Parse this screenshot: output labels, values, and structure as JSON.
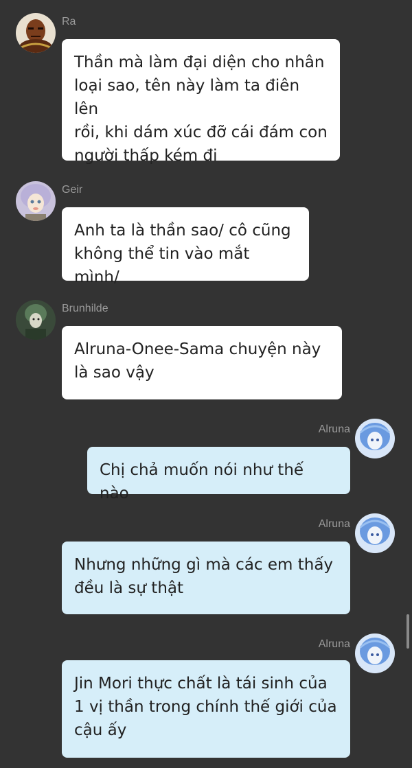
{
  "messages": [
    {
      "sender": "Ra",
      "side": "incoming",
      "text": "Thần mà làm đại diện cho nhân\nloại sao, tên này làm ta điên lên\nrồi, khi dám xúc đỡ cái đám con\nngười thấp kém đi"
    },
    {
      "sender": "Geir",
      "side": "incoming",
      "text": "Anh ta là thần sao/ cô cũng\nkhông thể tin vào mắt mình/"
    },
    {
      "sender": "Brunhilde",
      "side": "incoming",
      "text": "Alruna-Onee-Sama chuyện này\nlà sao vậy"
    },
    {
      "sender": "Alruna",
      "side": "outgoing",
      "text": "Chị chả muốn nói như thế nào"
    },
    {
      "sender": "Alruna",
      "side": "outgoing",
      "text": "Nhưng những gì mà các em thấy\nđều là sự thật"
    },
    {
      "sender": "Alruna",
      "side": "outgoing",
      "text": "Jin Mori thực chất là tái sinh của\n1 vị thần trong chính thế giới của\ncậu ấy"
    }
  ],
  "avatars": {
    "ra": "ra-avatar-icon",
    "geir": "geir-avatar-icon",
    "brunhilde": "brunhilde-avatar-icon",
    "alruna": "alruna-avatar-icon"
  },
  "colors": {
    "background": "#333333",
    "incoming_bubble": "#ffffff",
    "outgoing_bubble": "#d6eef9",
    "sender_name": "#9a9a9a"
  }
}
